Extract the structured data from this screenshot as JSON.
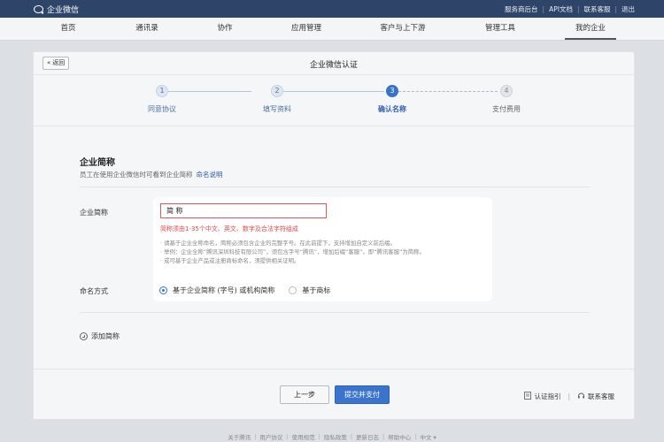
{
  "app": {
    "logo_text": "企业微信"
  },
  "top_links": [
    "服务商后台",
    "API文档",
    "联系客服",
    "退出"
  ],
  "nav": {
    "items": [
      "首页",
      "通讯录",
      "协作",
      "应用管理",
      "客户与上下游",
      "管理工具",
      "我的企业"
    ],
    "active": "我的企业"
  },
  "page": {
    "back_label": "返回",
    "title": "企业微信认证"
  },
  "steps": [
    {
      "number": "1",
      "label": "同意协议",
      "state": "done"
    },
    {
      "number": "2",
      "label": "填写资料",
      "state": "done"
    },
    {
      "number": "3",
      "label": "确认名称",
      "state": "current"
    },
    {
      "number": "4",
      "label": "支付费用",
      "state": "todo"
    }
  ],
  "section": {
    "title": "企业简称",
    "desc": "员工在使用企业微信时可看到企业简称",
    "desc_link": "命名说明"
  },
  "form": {
    "short_name_label": "企业简称",
    "short_name_value": "简 称",
    "error": "简称须由1-35个中文、英文、数字及合法字符组成",
    "notes": [
      "· 请基于企业全称命名，简称必须包含企业的完整字号。在此前提下，支持增加自定义前后缀。",
      "· 举例：企业全称“腾讯深圳科技有限公司”，须包含字号“腾讯”，增加后缀“客服”，即“腾讯客服”为简称。",
      "· 或可基于企业产品或注册商标命名，须提供相关证明。"
    ],
    "naming_label": "命名方式",
    "naming_options": [
      "基于企业简称 (字号) 或机构简称",
      "基于商标"
    ],
    "naming_selected": 0,
    "add_short_label": "添加简称"
  },
  "actions": {
    "prev": "上一步",
    "submit": "提交并支付"
  },
  "help_links": {
    "guide": "认证指引",
    "support": "联系客服"
  },
  "footer_links": [
    "关于腾讯",
    "用户协议",
    "使用规范",
    "隐私政策",
    "更新日志",
    "帮助中心",
    "中文"
  ],
  "colors": {
    "topbar": "#2e4468",
    "accent": "#3a72c9",
    "error": "#e0474a"
  }
}
